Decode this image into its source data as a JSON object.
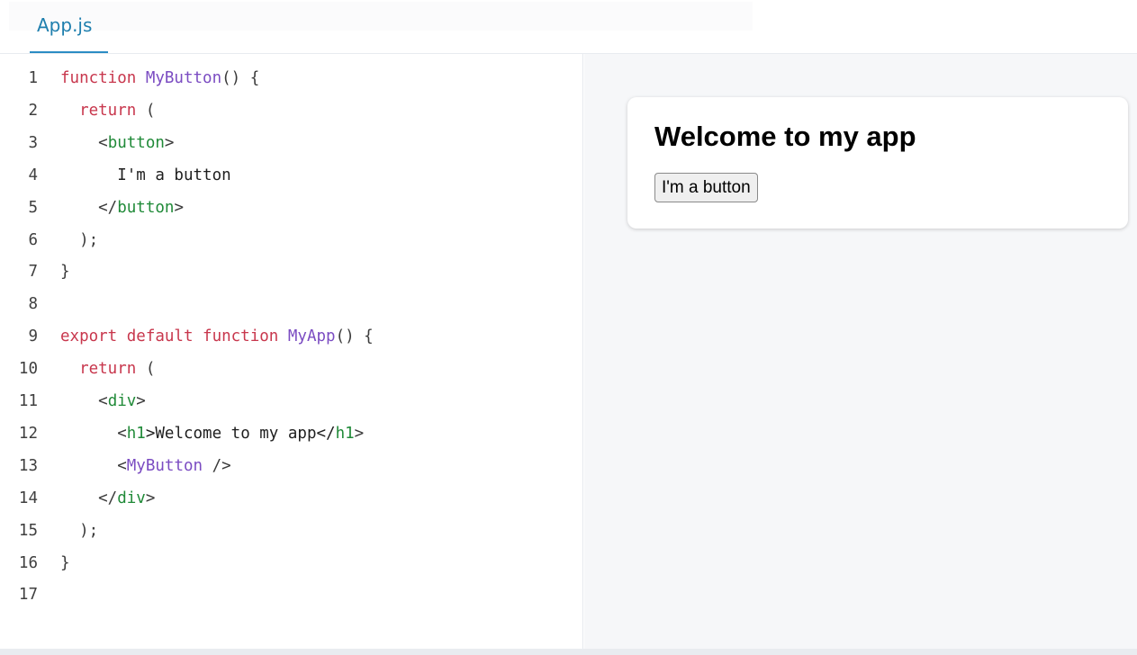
{
  "tabs": [
    {
      "label": "App.js",
      "active": true
    }
  ],
  "editor": {
    "lines": [
      {
        "num": "1",
        "parts": [
          {
            "t": "function ",
            "c": "kw"
          },
          {
            "t": "MyButton",
            "c": "fn"
          },
          {
            "t": "() {",
            "c": "pn"
          }
        ]
      },
      {
        "num": "2",
        "parts": [
          {
            "t": "  ",
            "c": "pn"
          },
          {
            "t": "return",
            "c": "kw"
          },
          {
            "t": " (",
            "c": "pn"
          }
        ]
      },
      {
        "num": "3",
        "parts": [
          {
            "t": "    <",
            "c": "pn"
          },
          {
            "t": "button",
            "c": "tag"
          },
          {
            "t": ">",
            "c": "pn"
          }
        ]
      },
      {
        "num": "4",
        "parts": [
          {
            "t": "      I'm a button",
            "c": "txt"
          }
        ]
      },
      {
        "num": "5",
        "parts": [
          {
            "t": "    </",
            "c": "pn"
          },
          {
            "t": "button",
            "c": "tag"
          },
          {
            "t": ">",
            "c": "pn"
          }
        ]
      },
      {
        "num": "6",
        "parts": [
          {
            "t": "  );",
            "c": "pn"
          }
        ]
      },
      {
        "num": "7",
        "parts": [
          {
            "t": "}",
            "c": "pn"
          }
        ]
      },
      {
        "num": "8",
        "parts": []
      },
      {
        "num": "9",
        "parts": [
          {
            "t": "export default function ",
            "c": "kw"
          },
          {
            "t": "MyApp",
            "c": "fn"
          },
          {
            "t": "() {",
            "c": "pn"
          }
        ]
      },
      {
        "num": "10",
        "parts": [
          {
            "t": "  ",
            "c": "pn"
          },
          {
            "t": "return",
            "c": "kw"
          },
          {
            "t": " (",
            "c": "pn"
          }
        ]
      },
      {
        "num": "11",
        "parts": [
          {
            "t": "    <",
            "c": "pn"
          },
          {
            "t": "div",
            "c": "tag"
          },
          {
            "t": ">",
            "c": "pn"
          }
        ]
      },
      {
        "num": "12",
        "parts": [
          {
            "t": "      <",
            "c": "pn"
          },
          {
            "t": "h1",
            "c": "tag"
          },
          {
            "t": ">Welcome to my app</",
            "c": "txt"
          },
          {
            "t": "h1",
            "c": "tag"
          },
          {
            "t": ">",
            "c": "pn"
          }
        ]
      },
      {
        "num": "13",
        "parts": [
          {
            "t": "      <",
            "c": "pn"
          },
          {
            "t": "MyButton",
            "c": "fn"
          },
          {
            "t": " />",
            "c": "pn"
          }
        ]
      },
      {
        "num": "14",
        "parts": [
          {
            "t": "    </",
            "c": "pn"
          },
          {
            "t": "div",
            "c": "tag"
          },
          {
            "t": ">",
            "c": "pn"
          }
        ]
      },
      {
        "num": "15",
        "parts": [
          {
            "t": "  );",
            "c": "pn"
          }
        ]
      },
      {
        "num": "16",
        "parts": [
          {
            "t": "}",
            "c": "pn"
          }
        ]
      },
      {
        "num": "17",
        "parts": []
      }
    ]
  },
  "preview": {
    "heading": "Welcome to my app",
    "button_label": "I'm a button"
  },
  "colors": {
    "keyword": "#c8374d",
    "function_name": "#7b4cc2",
    "tag_name": "#208a38",
    "tab_accent": "#1f7fae"
  }
}
